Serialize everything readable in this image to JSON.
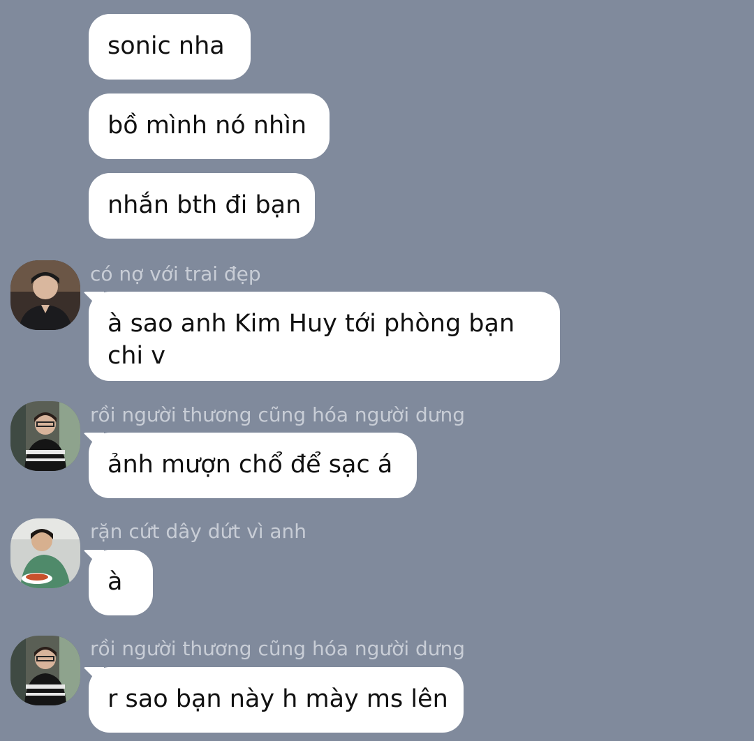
{
  "colors": {
    "background": "#808a9c",
    "bubble": "#ffffff",
    "text": "#111111",
    "sender_name": "#c8cdd6"
  },
  "messages": [
    {
      "text": "sonic nha"
    },
    {
      "text": "bồ mình nó nhìn"
    },
    {
      "text": "nhắn bth đi bạn"
    },
    {
      "sender": "có nợ với trai đẹp",
      "text": "à sao anh Kim Huy tới phòng bạn chi v",
      "avatar": "avatar-icon"
    },
    {
      "sender": "rồi người thương cũng hóa người dưng",
      "text": "ảnh mượn chổ để sạc á",
      "avatar": "avatar-icon"
    },
    {
      "sender": "rặn cứt dây dứt vì anh",
      "text": "à",
      "avatar": "avatar-icon"
    },
    {
      "sender": "rồi người thương cũng hóa người dưng",
      "text": "r sao bạn này h mày ms lên",
      "avatar": "avatar-icon"
    }
  ]
}
